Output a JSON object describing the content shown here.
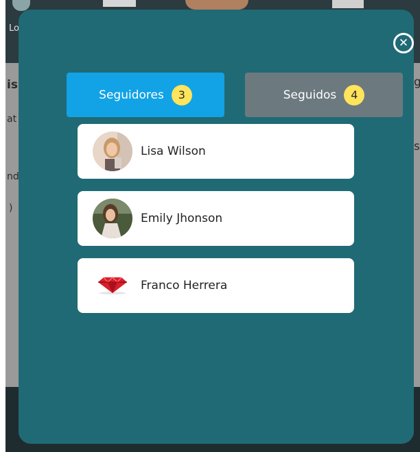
{
  "background_page": {
    "fragments": [
      "Lo",
      "is",
      "at",
      "nd",
      ")",
      "g",
      "s"
    ]
  },
  "modal": {
    "close_icon": "close-circle-icon",
    "tabs": [
      {
        "label": "Seguidores",
        "count": "3",
        "color": "#12a3e6",
        "active": true
      },
      {
        "label": "Seguidos",
        "count": "4",
        "color": "#6c7a80",
        "active": false
      }
    ],
    "users": [
      {
        "name": "Lisa Wilson",
        "avatar": "woman-photo-avatar"
      },
      {
        "name": "Emily Jhonson",
        "avatar": "woman-photo-avatar"
      },
      {
        "name": "Franco Herrera",
        "avatar": "red-diamond-avatar"
      }
    ]
  },
  "colors": {
    "modal_bg": "#206a75",
    "badge": "#ffe45c"
  }
}
